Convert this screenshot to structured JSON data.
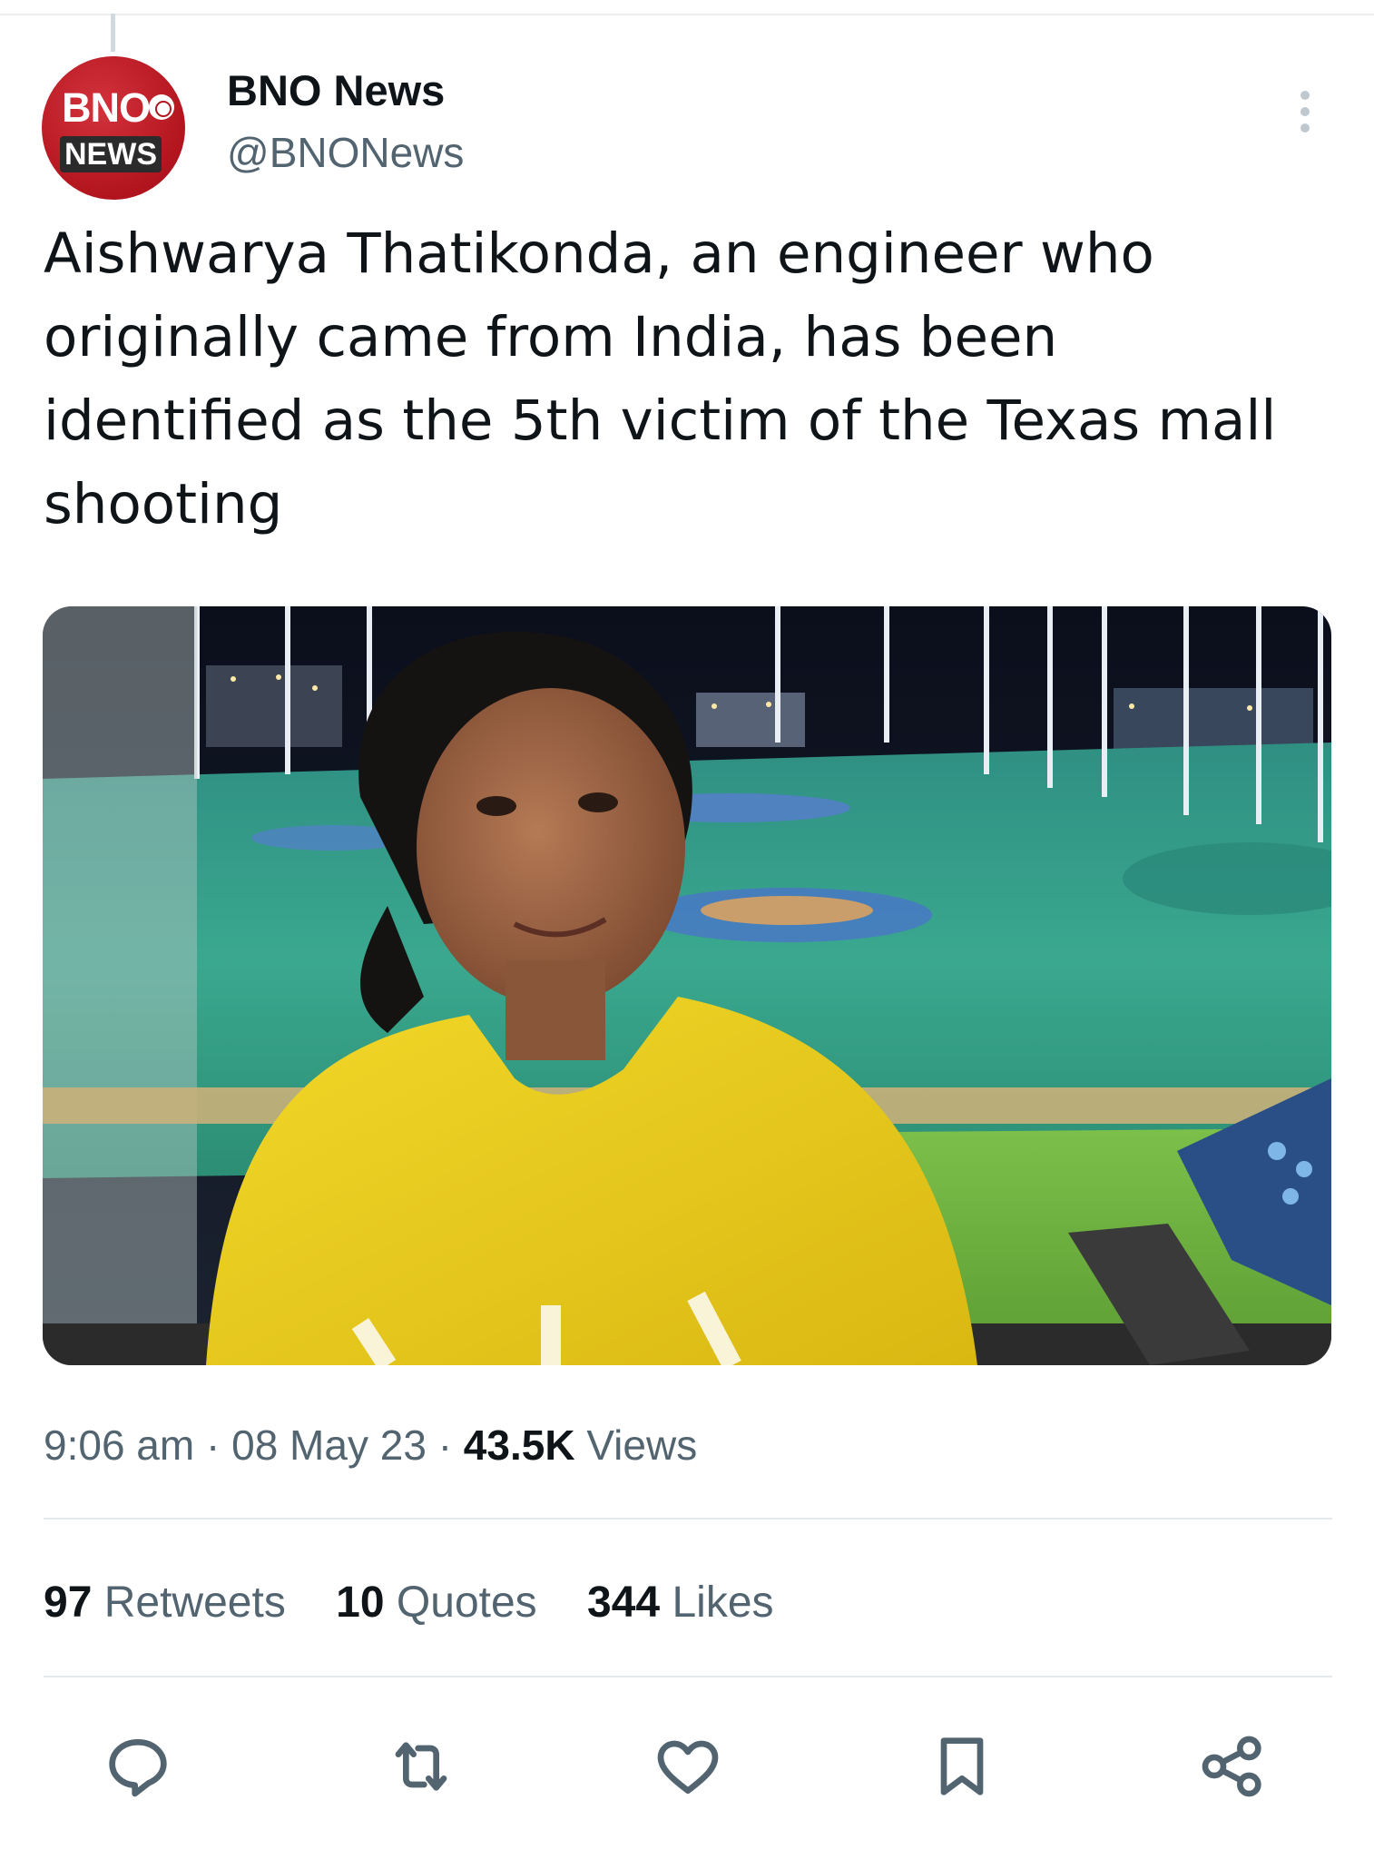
{
  "author": {
    "avatar_line1": "BNO",
    "avatar_line2": "NEWS",
    "display_name": "BNO News",
    "handle": "@BNONews"
  },
  "tweet": {
    "text_lines": [
      "Aishwarya Thatikonda, an engineer who",
      "originally came from India, has been",
      "identified as the 5th victim of the Texas mall",
      "shooting"
    ],
    "photo_description": "Woman in a yellow sweatshirt at a lit golf driving range at night"
  },
  "meta": {
    "time": "9:06 am",
    "date": "08 May 23",
    "views_count": "43.5K",
    "views_label": "Views",
    "separator": "·"
  },
  "stats": {
    "retweets_count": "97",
    "retweets_label": "Retweets",
    "quotes_count": "10",
    "quotes_label": "Quotes",
    "likes_count": "344",
    "likes_label": "Likes"
  },
  "actions": {
    "reply": "reply-icon",
    "retweet": "retweet-icon",
    "like": "heart-icon",
    "bookmark": "bookmark-icon",
    "share": "share-icon"
  },
  "colors": {
    "text": "#0f1419",
    "secondary": "#536471",
    "avatar_red": "#b3151f",
    "icon": "#536471"
  }
}
